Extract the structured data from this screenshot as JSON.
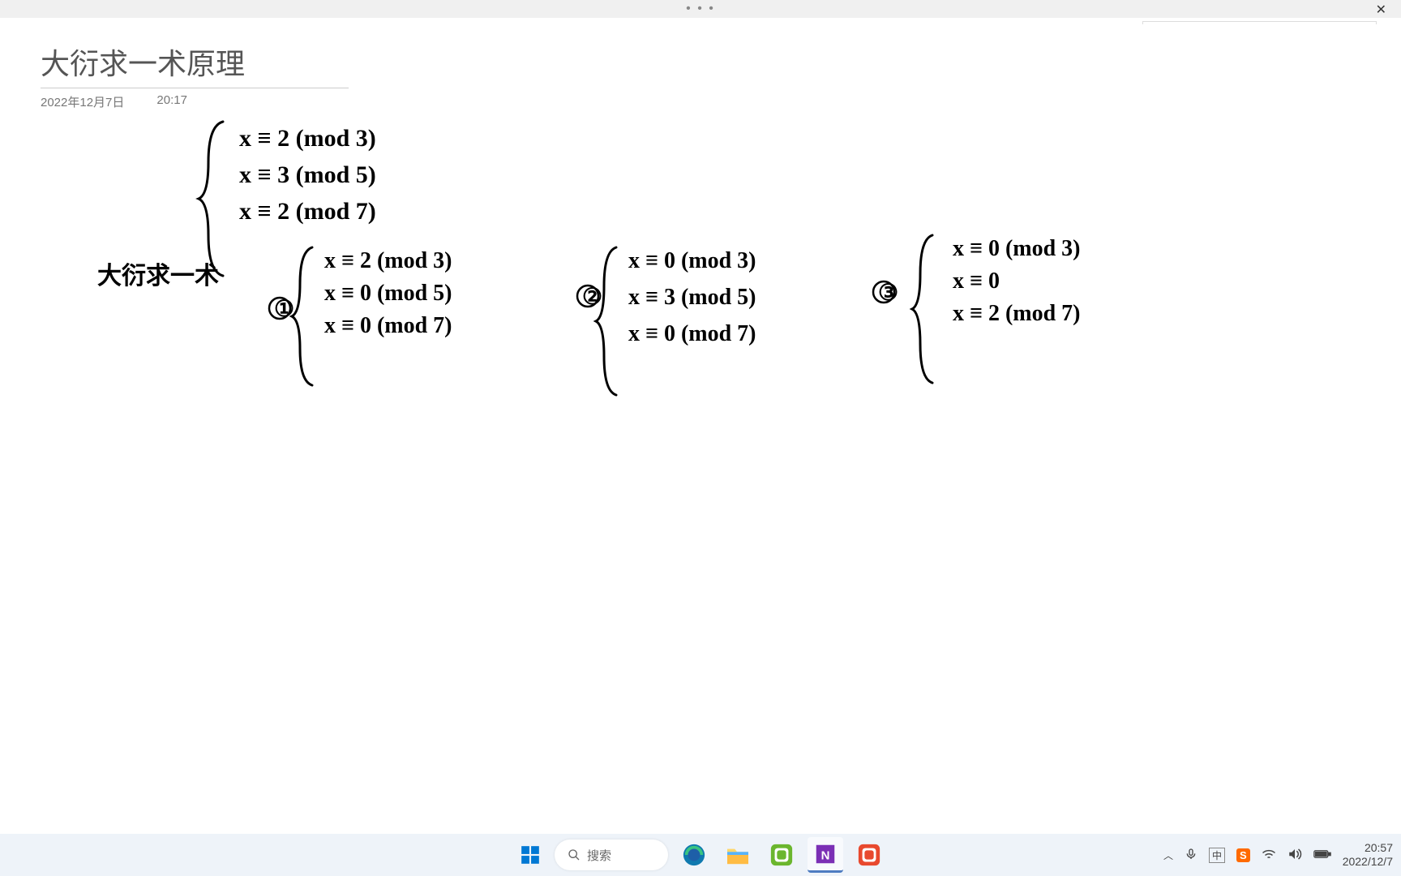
{
  "titlebar": {
    "dots": "• • •",
    "close": "✕"
  },
  "ime": {
    "sogou": "S",
    "lang": "中",
    "punct": "，",
    "mic": "🎤",
    "kbd": "⌨",
    "skin": "👕",
    "grid": "⊞",
    "arrow": "↗"
  },
  "note": {
    "title": "大衍求一术原理",
    "date": "2022年12月7日",
    "time": "20:17"
  },
  "ink": {
    "main_system": [
      "x ≡ 2 (mod 3)",
      "x ≡ 3 (mod 5)",
      "x ≡ 2 (mod 7)"
    ],
    "method_label": "大衍求一术",
    "subproblem1": {
      "tag": "①",
      "lines": [
        "x ≡ 2 (mod 3)",
        "x ≡ 0 (mod 5)",
        "x ≡ 0 (mod 7)"
      ]
    },
    "subproblem2": {
      "tag": "②",
      "lines": [
        "x ≡ 0 (mod 3)",
        "x ≡ 3 (mod 5)",
        "x ≡ 0 (mod 7)"
      ]
    },
    "subproblem3": {
      "tag": "③",
      "lines": [
        "x ≡ 0 (mod 3)",
        "x ≡ 0",
        "x ≡ 2 (mod 7)"
      ]
    }
  },
  "taskbar": {
    "search_placeholder": "搜索"
  },
  "tray": {
    "time": "20:57",
    "date": "2022/12/7"
  }
}
